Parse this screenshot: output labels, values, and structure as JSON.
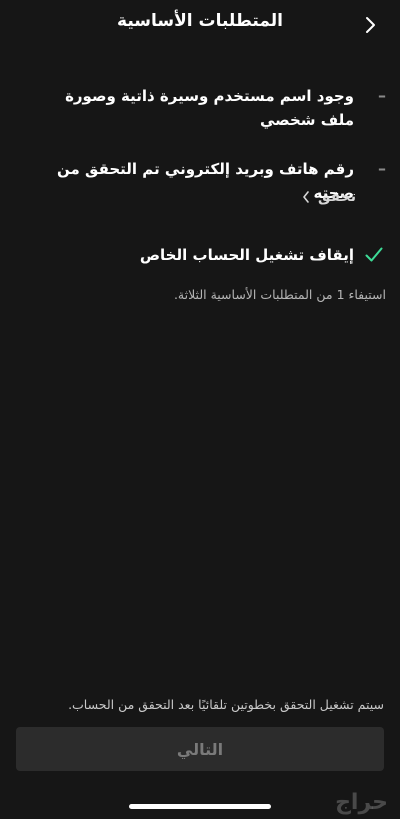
{
  "header": {
    "title": "المتطلبات الأساسية",
    "back_icon": "chevron-right-icon"
  },
  "requirements": [
    {
      "text": "وجود اسم مستخدم وسيرة ذاتية وصورة ملف شخصي",
      "status": "pending"
    },
    {
      "text": "رقم هاتف وبريد إلكتروني تم التحقق من صحته",
      "status": "pending",
      "action_label": "تحقق"
    },
    {
      "text": "إيقاف تشغيل الحساب الخاص",
      "status": "done"
    }
  ],
  "status_note": "استيفاء 1 من المتطلبات الأساسية الثلاثة.",
  "footer": {
    "note": "سيتم تشغيل التحقق بخطوتين تلقائيًا بعد التحقق من الحساب.",
    "next_label": "التالي"
  },
  "watermark": "حراج",
  "colors": {
    "background": "#161616",
    "check": "#3ddc97",
    "button_disabled_bg": "#2c2c2c"
  }
}
